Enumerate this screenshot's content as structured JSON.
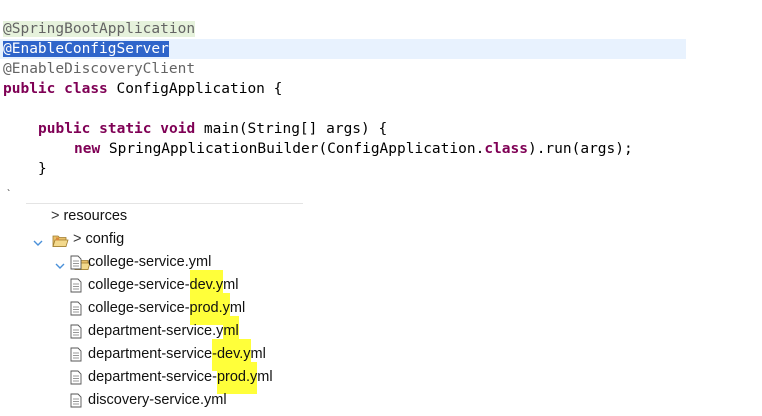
{
  "code": {
    "annotation_app": "@SpringBootApplication",
    "annotation_config": "@EnableConfigServer",
    "annotation_discovery": "@EnableDiscoveryClient",
    "class_kw_public": "public",
    "class_kw_class": "class",
    "class_name_rest": " ConfigApplication {",
    "main_kw_public": "public",
    "main_kw_static": "static",
    "main_kw_void": "void",
    "main_signature_rest": " main(String[] args) {",
    "body_kw_new": "new",
    "body_before_class": " SpringApplicationBuilder(ConfigApplication.",
    "body_kw_class": "class",
    "body_after_class": ").run(args);",
    "close_brace": "}"
  },
  "tree": {
    "resources_label": "resources",
    "config_label": "config",
    "gt_symbol": ">",
    "files": [
      {
        "pre": "college-service.yml",
        "hl": "",
        "post": ""
      },
      {
        "pre": "college-service-",
        "hl": "dev.y",
        "post": "ml"
      },
      {
        "pre": "college-service-",
        "hl": "prod.y",
        "post": "ml"
      },
      {
        "pre": "department-service.y",
        "hl": "ml",
        "post": ""
      },
      {
        "pre": "department-service",
        "hl": "-dev.y",
        "post": "ml"
      },
      {
        "pre": "department-service-",
        "hl": "prod.y",
        "post": "ml"
      },
      {
        "pre": "discovery-service.yml",
        "hl": "",
        "post": ""
      }
    ]
  },
  "colors": {
    "keyword": "#7f0055",
    "annotation": "#646464",
    "selection": "#2f65ca",
    "current_line": "#e8f2fe",
    "highlighter": "#ffff3a"
  },
  "icons": {
    "expand": "chevron-down-icon",
    "folder": "folder-open-icon",
    "file": "yml-file-icon"
  }
}
